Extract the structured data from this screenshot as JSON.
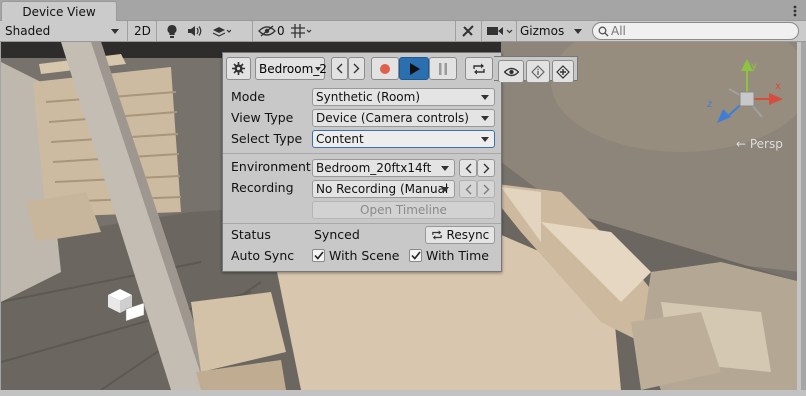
{
  "tab": {
    "label": "Device View"
  },
  "toolbar": {
    "shading_mode": "Shaded",
    "btn_2d": "2D",
    "hidden_count": "0",
    "gizmos_label": "Gizmos",
    "search_placeholder": "All"
  },
  "scene": {
    "persp_label": "← Persp",
    "gizmo_axes": {
      "x_color": "#d44d3d",
      "y_color": "#8bc43e",
      "z_color": "#3f7ed6"
    }
  },
  "panel": {
    "toolbar": {
      "environment_short": "Bedroom_2",
      "record_color": "#e0604e",
      "play_active_color": "#2a6fb0"
    },
    "rows": {
      "mode": {
        "label": "Mode",
        "value": "Synthetic (Room)"
      },
      "view_type": {
        "label": "View Type",
        "value": "Device (Camera controls)"
      },
      "select_type": {
        "label": "Select Type",
        "value": "Content"
      },
      "environment": {
        "label": "Environment",
        "value": "Bedroom_20ftx14ft"
      },
      "recording": {
        "label": "Recording",
        "value": "No Recording (Manual"
      },
      "open_timeline": "Open Timeline",
      "status": {
        "label": "Status",
        "value": "Synced",
        "resync": "Resync"
      },
      "auto_sync": {
        "label": "Auto Sync",
        "with_scene": "With Scene",
        "with_scene_checked": true,
        "with_time": "With Time",
        "with_time_checked": true
      }
    }
  }
}
